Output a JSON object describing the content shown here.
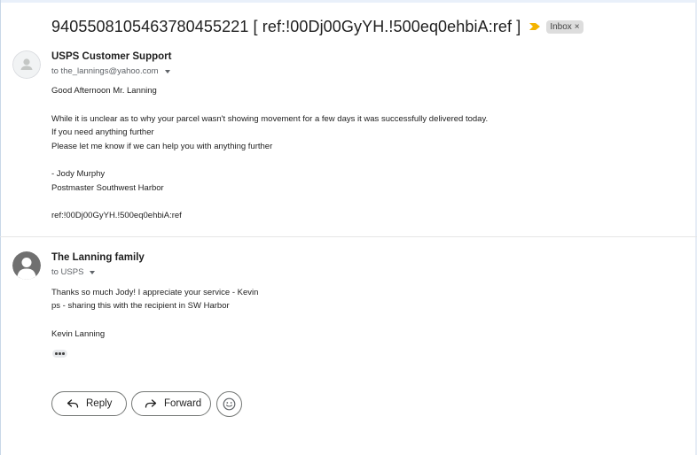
{
  "thread": {
    "subject": "9405508105463780455221 [ ref:!00Dj00GyYH.!500eq0ehbiA:ref ]",
    "label": "Inbox",
    "label_remove": "×",
    "importance_color": "#f4b400"
  },
  "messages": [
    {
      "sender": "USPS Customer Support",
      "recipient": "to the_lannings@yahoo.com",
      "avatar": "default-person-icon",
      "body": [
        "Good Afternoon Mr. Lanning",
        "While it is unclear as to why your parcel wasn't showing movement for a few days it was successfully delivered today.",
        "If you need anything further",
        "Please let me know if we can help you with anything further",
        "- Jody Murphy",
        "Postmaster Southwest Harbor",
        "ref:!00Dj00GyYH.!500eq0ehbiA:ref"
      ]
    },
    {
      "sender": "The Lanning family",
      "recipient": "to USPS",
      "avatar": "person-avatar-icon",
      "body": [
        "Thanks so much Jody! I appreciate your service - Kevin",
        "ps - sharing this with the recipient in SW Harbor",
        "Kevin Lanning"
      ]
    }
  ],
  "actions": {
    "reply_label": "Reply",
    "forward_label": "Forward",
    "emoji_icon": "smiley-icon"
  }
}
